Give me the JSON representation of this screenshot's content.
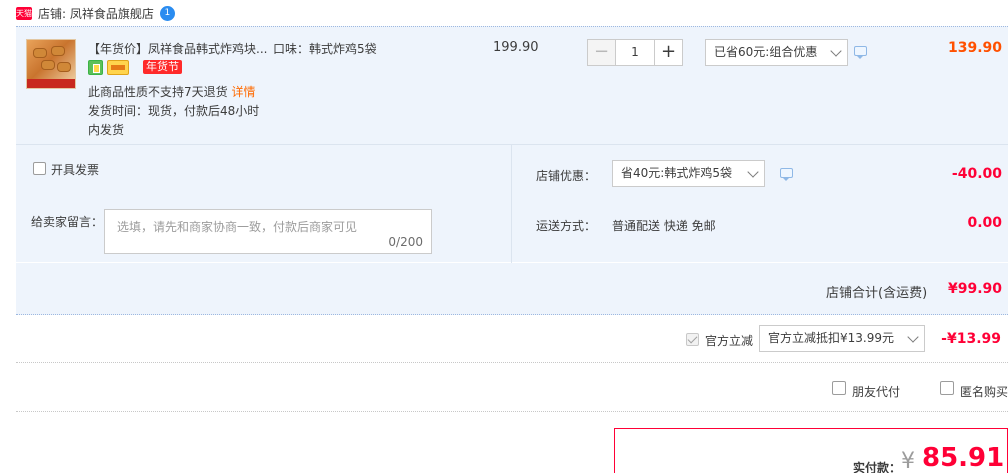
{
  "shop": {
    "tmall_badge": "天猫",
    "label": "店铺: 凤祥食品旗舰店",
    "chat_badge": "1"
  },
  "item": {
    "title": "【年货价】凤祥食品韩式炸鸡块...",
    "sku": "口味：韩式炸鸡5袋",
    "festival_badge": "年货节",
    "no_return_note": "此商品性质不支持7天退货",
    "detail_link": "详情",
    "ship_time_line1": "发货时间：现货，付款后48小时",
    "ship_time_line2": "内发货",
    "unit_price": "199.90",
    "quantity": "1",
    "minus_glyph": "−",
    "plus_glyph": "+",
    "promo_select": "已省60元:组合优惠",
    "subtotal": "139.90"
  },
  "invoice": {
    "label": "开具发票"
  },
  "memo": {
    "label": "给卖家留言：",
    "placeholder": "选填，请先和商家协商一致，付款后商家可见",
    "counter": "0/200"
  },
  "shop_discount": {
    "label": "店铺优惠：",
    "select": "省40元:韩式炸鸡5袋",
    "amount": "-40.00"
  },
  "shipping": {
    "label": "运送方式：",
    "method": "普通配送 快递 免邮",
    "amount": "0.00"
  },
  "shop_total": {
    "label": "店铺合计(含运费)",
    "amount": "¥99.90"
  },
  "official_discount": {
    "label": "官方立减",
    "select": "官方立减抵扣¥13.99元",
    "amount": "-¥13.99"
  },
  "friend_pay": {
    "label": "朋友代付"
  },
  "anonymous": {
    "label": "匿名购买"
  },
  "payment": {
    "label": "实付款：",
    "currency": "¥",
    "amount": "85.91"
  },
  "colors": {
    "accent_red": "#ff0036",
    "orange_price": "#ff5000",
    "panel_bg": "#eef4fc"
  },
  "icons": [
    "tmall-logo-icon",
    "chat-icon",
    "message-icon",
    "chevron-down-icon",
    "checkbox-icon"
  ]
}
